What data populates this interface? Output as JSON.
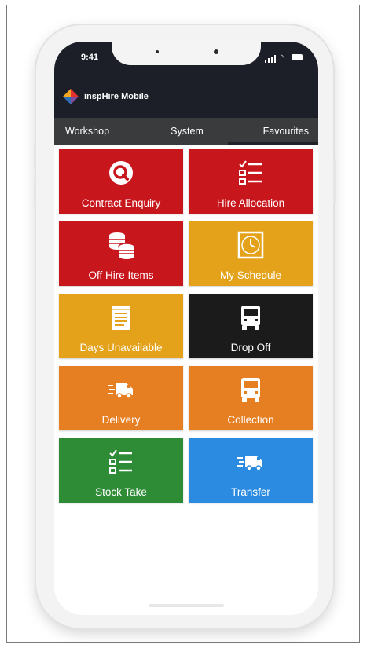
{
  "status_bar": {
    "time": "9:41"
  },
  "app": {
    "title": "inspHire Mobile"
  },
  "tabs": [
    {
      "label": "Workshop",
      "active": false
    },
    {
      "label": "System",
      "active": false
    },
    {
      "label": "Favourites",
      "active": true
    }
  ],
  "tiles": [
    {
      "label": "Contract Enquiry",
      "color": "#c8161d",
      "icon": "search-icon"
    },
    {
      "label": "Hire Allocation",
      "color": "#c8161d",
      "icon": "checklist-icon"
    },
    {
      "label": "Off Hire Items",
      "color": "#c8161d",
      "icon": "coins-stack-icon"
    },
    {
      "label": "My Schedule",
      "color": "#e3a21a",
      "icon": "clock-icon"
    },
    {
      "label": "Days Unavailable",
      "color": "#e3a21a",
      "icon": "notepad-icon"
    },
    {
      "label": "Drop Off",
      "color": "#1b1b1b",
      "icon": "truck-front-icon"
    },
    {
      "label": "Delivery",
      "color": "#e67e22",
      "icon": "fast-van-icon"
    },
    {
      "label": "Collection",
      "color": "#e67e22",
      "icon": "truck-front-icon"
    },
    {
      "label": "Stock Take",
      "color": "#2e8b36",
      "icon": "checklist-icon"
    },
    {
      "label": "Transfer",
      "color": "#2b8be0",
      "icon": "fast-van-icon"
    }
  ]
}
